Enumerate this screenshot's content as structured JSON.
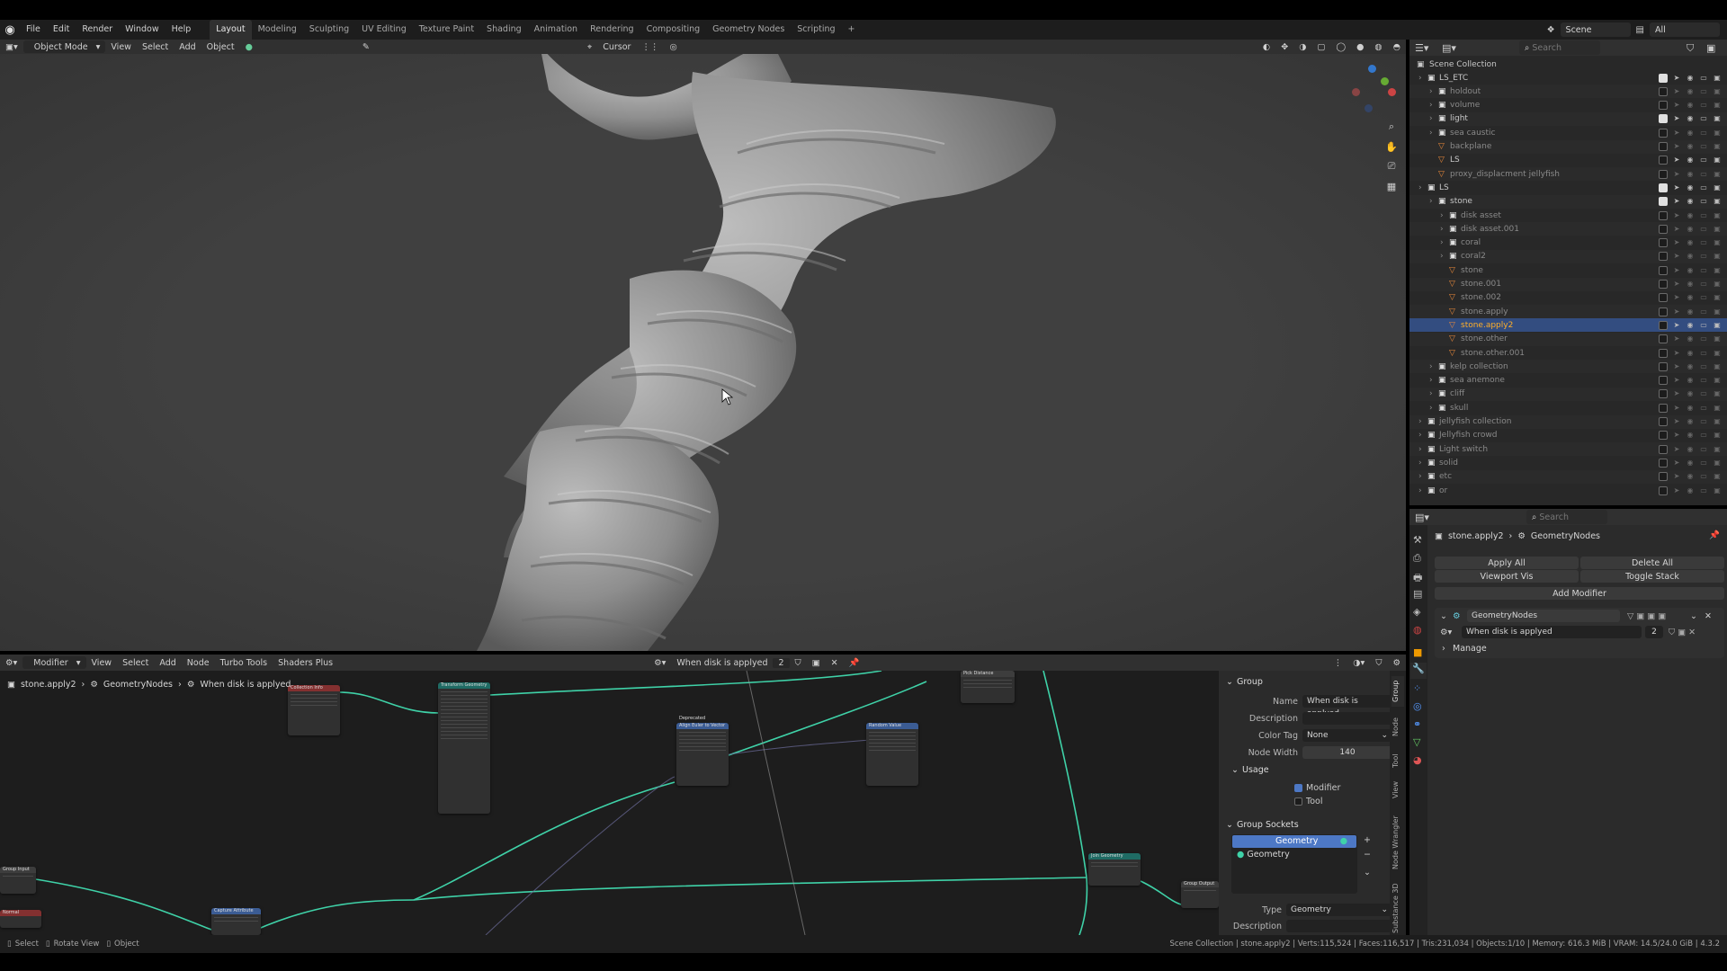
{
  "menu": {
    "items": [
      "File",
      "Edit",
      "Render",
      "Window",
      "Help"
    ],
    "workspaces": [
      "Layout",
      "Modeling",
      "Sculpting",
      "UV Editing",
      "Texture Paint",
      "Shading",
      "Animation",
      "Rendering",
      "Compositing",
      "Geometry Nodes",
      "Scripting"
    ],
    "active_workspace": "Layout",
    "add_tab": "+",
    "scene": "Scene",
    "view_layer": "All"
  },
  "viewport_header": {
    "mode": "Object Mode",
    "menus": [
      "View",
      "Select",
      "Add",
      "Object"
    ],
    "pivot": "Cursor"
  },
  "outliner": {
    "search_placeholder": "Search",
    "root": "Scene Collection",
    "rows": [
      {
        "name": "LS_ETC",
        "indent": 1,
        "kind": "collection",
        "checked": true
      },
      {
        "name": "holdout",
        "indent": 2,
        "kind": "collection",
        "dim": true
      },
      {
        "name": "volume",
        "indent": 2,
        "kind": "collection",
        "dim": true
      },
      {
        "name": "light",
        "indent": 2,
        "kind": "collection",
        "checked": true
      },
      {
        "name": "sea caustic",
        "indent": 2,
        "kind": "collection",
        "dim": true
      },
      {
        "name": "backplane",
        "indent": 2,
        "kind": "object",
        "dim": true
      },
      {
        "name": "LS",
        "indent": 2,
        "kind": "object"
      },
      {
        "name": "proxy_displacment jellyfish",
        "indent": 2,
        "kind": "object",
        "dim": true
      },
      {
        "name": "LS",
        "indent": 1,
        "kind": "collection",
        "checked": true
      },
      {
        "name": "stone",
        "indent": 2,
        "kind": "collection",
        "checked": true
      },
      {
        "name": "disk asset",
        "indent": 3,
        "kind": "collection",
        "dim": true
      },
      {
        "name": "disk asset.001",
        "indent": 3,
        "kind": "collection",
        "dim": true
      },
      {
        "name": "coral",
        "indent": 3,
        "kind": "collection",
        "dim": true
      },
      {
        "name": "coral2",
        "indent": 3,
        "kind": "collection",
        "dim": true
      },
      {
        "name": "stone",
        "indent": 3,
        "kind": "object",
        "dim": true
      },
      {
        "name": "stone.001",
        "indent": 3,
        "kind": "object",
        "dim": true
      },
      {
        "name": "stone.002",
        "indent": 3,
        "kind": "object",
        "dim": true
      },
      {
        "name": "stone.apply",
        "indent": 3,
        "kind": "object",
        "dim": true
      },
      {
        "name": "stone.apply2",
        "indent": 3,
        "kind": "object",
        "selected": true
      },
      {
        "name": "stone.other",
        "indent": 3,
        "kind": "object",
        "dim": true
      },
      {
        "name": "stone.other.001",
        "indent": 3,
        "kind": "object",
        "dim": true
      },
      {
        "name": "kelp collection",
        "indent": 2,
        "kind": "collection",
        "dim": true
      },
      {
        "name": "sea anemone",
        "indent": 2,
        "kind": "collection",
        "dim": true
      },
      {
        "name": "cliff",
        "indent": 2,
        "kind": "collection",
        "dim": true
      },
      {
        "name": "skull",
        "indent": 2,
        "kind": "collection",
        "dim": true
      },
      {
        "name": "jellyfish collection",
        "indent": 1,
        "kind": "collection",
        "dim": true
      },
      {
        "name": "Jellyfish crowd",
        "indent": 1,
        "kind": "collection",
        "dim": true
      },
      {
        "name": "Light switch",
        "indent": 1,
        "kind": "collection",
        "dim": true
      },
      {
        "name": "solid",
        "indent": 1,
        "kind": "collection",
        "dim": true
      },
      {
        "name": "etc",
        "indent": 1,
        "kind": "collection",
        "dim": true
      },
      {
        "name": "or",
        "indent": 1,
        "kind": "collection",
        "dim": true
      }
    ]
  },
  "properties": {
    "search_placeholder": "Search",
    "breadcrumb_object": "stone.apply2",
    "breadcrumb_modifier": "GeometryNodes",
    "apply_all": "Apply All",
    "delete_all": "Delete All",
    "viewport_vis": "Viewport Vis",
    "toggle_stack": "Toggle Stack",
    "add_modifier": "Add Modifier",
    "modifier_name": "GeometryNodes",
    "node_group": "When disk is applyed",
    "user_count": "2",
    "manage": "Manage"
  },
  "node_editor": {
    "editor_type": "Modifier",
    "menus": [
      "View",
      "Select",
      "Add",
      "Node",
      "Turbo Tools",
      "Shaders Plus"
    ],
    "node_group": "When disk is applyed",
    "user_count": "2",
    "breadcrumb": [
      "stone.apply2",
      "GeometryNodes",
      "When disk is applyed"
    ],
    "nodes": {
      "object_info": "Collection Info",
      "transform": "Transform Geometry",
      "deprecated": "Deprecated",
      "align": "Align Euler to Vector",
      "random": "Random Value",
      "pick_distance": "Pick Distance",
      "join": "Join Geometry",
      "group_output": "Group Output",
      "group_input": "Group Input",
      "capture": "Capture Attribute",
      "normal": "Normal"
    }
  },
  "side_panel": {
    "group_header": "Group",
    "name_label": "Name",
    "name_value": "When disk is applyed",
    "description_label": "Description",
    "color_tag_label": "Color Tag",
    "color_tag_value": "None",
    "node_width_label": "Node Width",
    "node_width_value": "140",
    "usage_header": "Usage",
    "modifier_label": "Modifier",
    "tool_label": "Tool",
    "sockets_header": "Group Sockets",
    "socket_out": "Geometry",
    "socket_in": "Geometry",
    "type_label": "Type",
    "type_value": "Geometry",
    "desc2_label": "Description",
    "tabs": [
      "Group",
      "Node",
      "Tool",
      "View",
      "Node Wrangler",
      "Substance 3D"
    ]
  },
  "statusbar": {
    "select": "Select",
    "rotate": "Rotate View",
    "object": "Object",
    "stats": "Scene Collection | stone.apply2 | Verts:115,524 | Faces:116,517 | Tris:231,034 | Objects:1/10 | Memory: 616.3 MiB | VRAM: 14.5/24.0 GiB | 4.3.2"
  },
  "colors": {
    "accent": "#334d80",
    "wire": "#3fd2a8",
    "selected_text": "#ffaf29"
  }
}
